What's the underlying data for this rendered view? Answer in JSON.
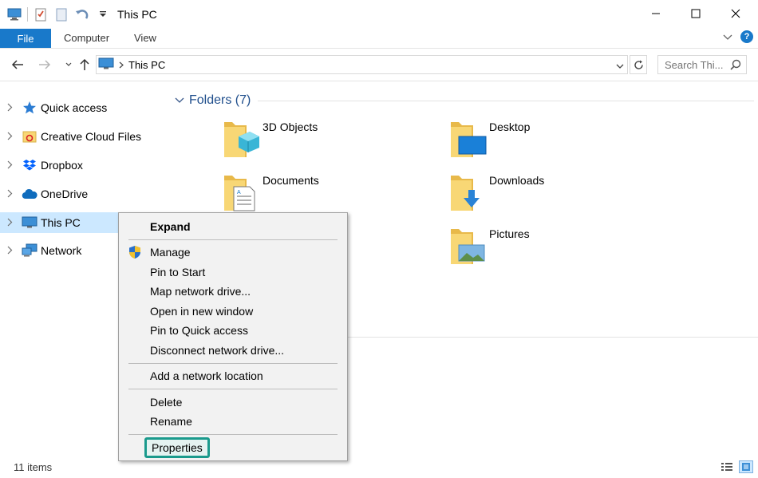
{
  "window": {
    "title": "This PC"
  },
  "ribbon": {
    "file_tab": "File",
    "tabs": [
      "Computer",
      "View"
    ]
  },
  "address": {
    "crumb": "This PC",
    "search_placeholder": "Search Thi..."
  },
  "nav_pane": {
    "items": [
      {
        "label": "Quick access",
        "icon": "star-icon"
      },
      {
        "label": "Creative Cloud Files",
        "icon": "creative-cloud-folder-icon"
      },
      {
        "label": "Dropbox",
        "icon": "dropbox-icon"
      },
      {
        "label": "OneDrive",
        "icon": "cloud-icon"
      },
      {
        "label": "This PC",
        "icon": "computer-icon"
      },
      {
        "label": "Network",
        "icon": "network-icon"
      }
    ]
  },
  "content": {
    "group_title": "Folders (7)",
    "folders": [
      {
        "label": "3D Objects",
        "icon": "3d-objects-folder-icon"
      },
      {
        "label": "Desktop",
        "icon": "desktop-folder-icon"
      },
      {
        "label": "Documents",
        "icon": "documents-folder-icon"
      },
      {
        "label": "Downloads",
        "icon": "downloads-folder-icon"
      },
      {
        "label": "Pictures",
        "icon": "pictures-folder-icon"
      }
    ]
  },
  "context_menu": {
    "items": [
      {
        "label": "Expand",
        "bold": true
      },
      {
        "label": "Manage",
        "icon": "shield-icon"
      },
      {
        "label": "Pin to Start"
      },
      {
        "label": "Map network drive..."
      },
      {
        "label": "Open in new window"
      },
      {
        "label": "Pin to Quick access"
      },
      {
        "label": "Disconnect network drive..."
      },
      {
        "label": "Add a network location"
      },
      {
        "label": "Delete"
      },
      {
        "label": "Rename"
      },
      {
        "label": "Properties",
        "highlighted": true
      }
    ]
  },
  "status": {
    "item_count": "11 items"
  },
  "colors": {
    "accent": "#1979ca",
    "selection": "#cce8ff",
    "highlight_box": "#1a9a8c",
    "folder_yellow": "#f8d775"
  }
}
